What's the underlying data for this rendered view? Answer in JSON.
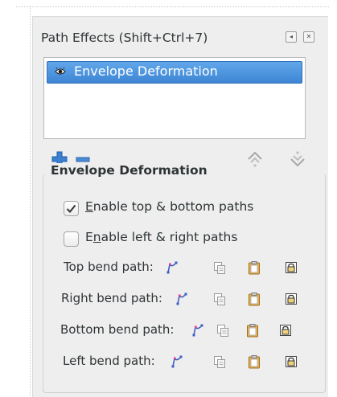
{
  "dialog": {
    "title": "Path Effects  (Shift+Ctrl+7)",
    "window_buttons": [
      "collapse-icon",
      "close-icon"
    ]
  },
  "effects_list": {
    "items": [
      {
        "label": "Envelope Deformation",
        "visible_icon": "eye-icon",
        "selected": true
      }
    ]
  },
  "toolbar": {
    "icons": [
      "add-effect-icon",
      "remove-effect-icon",
      "move-up-icon",
      "move-down-icon"
    ]
  },
  "settings": {
    "section_title": "Envelope Deformation",
    "checkboxes": [
      {
        "mnemonic": "E",
        "rest": "nable top & bottom paths",
        "checked": true
      },
      {
        "pre": "E",
        "mnemonic": "n",
        "rest": "able left & right paths",
        "checked": false
      }
    ],
    "path_params": [
      {
        "label": "Top bend path:"
      },
      {
        "label": "Right bend path:"
      },
      {
        "label": "Bottom bend path:"
      },
      {
        "label": "Left bend path:"
      }
    ],
    "param_icons": [
      "edit-on-canvas-icon",
      "copy-path-icon",
      "paste-path-icon",
      "link-path-icon"
    ]
  },
  "colors": {
    "selection": "#3d85d4",
    "add_icon": "#3a7fd0",
    "remove_icon": "#4a8bd6"
  }
}
